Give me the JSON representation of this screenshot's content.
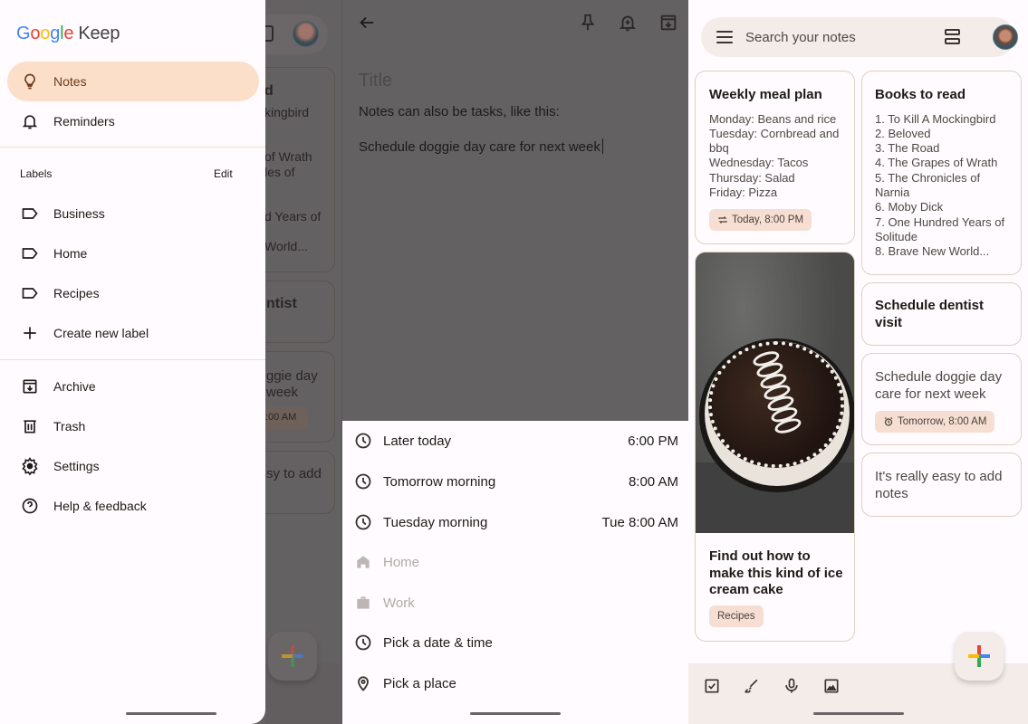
{
  "drawer": {
    "app_title": "Google Keep",
    "logo_letters": [
      "G",
      "o",
      "o",
      "g",
      "l",
      "e"
    ],
    "logo_product": "Keep",
    "primary_items": [
      {
        "label": "Notes",
        "icon": "lightbulb-icon",
        "active": true
      },
      {
        "label": "Reminders",
        "icon": "bell-icon",
        "active": false
      }
    ],
    "labels_heading": "Labels",
    "labels_edit": "Edit",
    "labels": [
      {
        "label": "Business",
        "icon": "label-icon"
      },
      {
        "label": "Home",
        "icon": "label-icon"
      },
      {
        "label": "Recipes",
        "icon": "label-icon"
      }
    ],
    "create_label": "Create new label",
    "secondary_items": [
      {
        "label": "Archive",
        "icon": "archive-icon"
      },
      {
        "label": "Trash",
        "icon": "trash-icon"
      },
      {
        "label": "Settings",
        "icon": "gear-icon"
      },
      {
        "label": "Help & feedback",
        "icon": "help-icon"
      }
    ],
    "background_peek": {
      "card1_title": "d",
      "card1_lines": [
        "kingbird",
        "",
        "",
        "of Wrath",
        "les of",
        "",
        "",
        "d Years of",
        "",
        "World..."
      ],
      "card2_title": "ntist",
      "card3_lines": [
        "ggie day",
        " week"
      ],
      "card3_chip": ":00 AM",
      "card4_lines": [
        "sy to add"
      ]
    }
  },
  "editor": {
    "title_placeholder": "Title",
    "lines": [
      "Notes can also be tasks, like this:",
      "Schedule doggie day care for next week"
    ],
    "reminder_options": [
      {
        "label": "Later today",
        "time": "6:00 PM",
        "icon": "clock-icon",
        "enabled": true
      },
      {
        "label": "Tomorrow morning",
        "time": "8:00 AM",
        "icon": "clock-icon",
        "enabled": true
      },
      {
        "label": "Tuesday morning",
        "time": "Tue 8:00 AM",
        "icon": "clock-icon",
        "enabled": true
      },
      {
        "label": "Home",
        "time": "",
        "icon": "home-icon",
        "enabled": false
      },
      {
        "label": "Work",
        "time": "",
        "icon": "briefcase-icon",
        "enabled": false
      },
      {
        "label": "Pick a date & time",
        "time": "",
        "icon": "clock-icon",
        "enabled": true
      },
      {
        "label": "Pick a place",
        "time": "",
        "icon": "location-pin-icon",
        "enabled": true
      }
    ]
  },
  "home": {
    "search_placeholder": "Search your notes",
    "notes": [
      {
        "title": "Weekly meal plan",
        "body": [
          "Monday: Beans and rice",
          "Tuesday: Cornbread and bbq",
          "Wednesday: Tacos",
          "Thursday: Salad",
          "Friday: Pizza"
        ],
        "chip": "Today, 8:00 PM",
        "chip_icon": "repeat-icon"
      },
      {
        "title": "Find out how to make this kind of ice cream cake",
        "image": "ice-cream-cake-photo",
        "chip": "Recipes"
      },
      {
        "title": "Books to read",
        "body": [
          "1. To Kill A Mockingbird",
          "2. Beloved",
          "3. The Road",
          "4. The Grapes of Wrath",
          "5. The Chronicles of Narnia",
          "6. Moby Dick",
          "7. One Hundred Years of Solitude",
          "8. Brave New World..."
        ]
      },
      {
        "title": "Schedule dentist visit"
      },
      {
        "body_text": "Schedule doggie day care for next week",
        "chip": "Tomorrow, 8:00 AM",
        "chip_icon": "alarm-icon"
      },
      {
        "body_text": "It's really easy to add notes"
      }
    ],
    "bottom_actions": [
      "checkbox-icon",
      "brush-icon",
      "microphone-icon",
      "image-icon"
    ],
    "fab": "new-note-plus-icon"
  },
  "colors": {
    "accent_active": "#fcdfc9",
    "chip_bg": "#f6dfd2",
    "card_border": "#e1cfc3",
    "scrim": "#646163"
  }
}
